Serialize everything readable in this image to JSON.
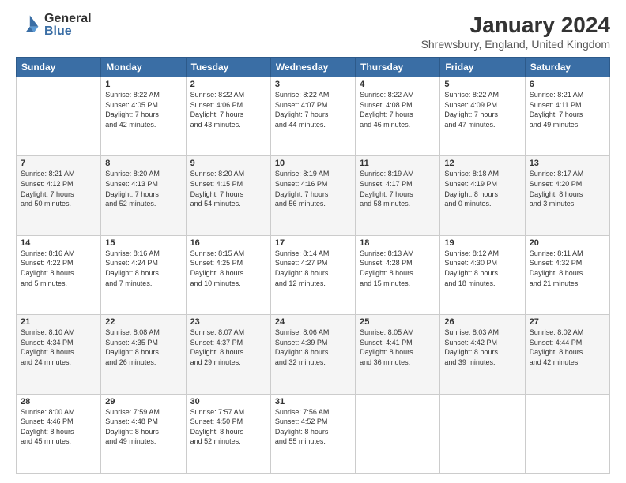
{
  "logo": {
    "general": "General",
    "blue": "Blue"
  },
  "title": "January 2024",
  "subtitle": "Shrewsbury, England, United Kingdom",
  "days_of_week": [
    "Sunday",
    "Monday",
    "Tuesday",
    "Wednesday",
    "Thursday",
    "Friday",
    "Saturday"
  ],
  "weeks": [
    [
      {
        "day": "",
        "info": ""
      },
      {
        "day": "1",
        "info": "Sunrise: 8:22 AM\nSunset: 4:05 PM\nDaylight: 7 hours\nand 42 minutes."
      },
      {
        "day": "2",
        "info": "Sunrise: 8:22 AM\nSunset: 4:06 PM\nDaylight: 7 hours\nand 43 minutes."
      },
      {
        "day": "3",
        "info": "Sunrise: 8:22 AM\nSunset: 4:07 PM\nDaylight: 7 hours\nand 44 minutes."
      },
      {
        "day": "4",
        "info": "Sunrise: 8:22 AM\nSunset: 4:08 PM\nDaylight: 7 hours\nand 46 minutes."
      },
      {
        "day": "5",
        "info": "Sunrise: 8:22 AM\nSunset: 4:09 PM\nDaylight: 7 hours\nand 47 minutes."
      },
      {
        "day": "6",
        "info": "Sunrise: 8:21 AM\nSunset: 4:11 PM\nDaylight: 7 hours\nand 49 minutes."
      }
    ],
    [
      {
        "day": "7",
        "info": "Sunrise: 8:21 AM\nSunset: 4:12 PM\nDaylight: 7 hours\nand 50 minutes."
      },
      {
        "day": "8",
        "info": "Sunrise: 8:20 AM\nSunset: 4:13 PM\nDaylight: 7 hours\nand 52 minutes."
      },
      {
        "day": "9",
        "info": "Sunrise: 8:20 AM\nSunset: 4:15 PM\nDaylight: 7 hours\nand 54 minutes."
      },
      {
        "day": "10",
        "info": "Sunrise: 8:19 AM\nSunset: 4:16 PM\nDaylight: 7 hours\nand 56 minutes."
      },
      {
        "day": "11",
        "info": "Sunrise: 8:19 AM\nSunset: 4:17 PM\nDaylight: 7 hours\nand 58 minutes."
      },
      {
        "day": "12",
        "info": "Sunrise: 8:18 AM\nSunset: 4:19 PM\nDaylight: 8 hours\nand 0 minutes."
      },
      {
        "day": "13",
        "info": "Sunrise: 8:17 AM\nSunset: 4:20 PM\nDaylight: 8 hours\nand 3 minutes."
      }
    ],
    [
      {
        "day": "14",
        "info": "Sunrise: 8:16 AM\nSunset: 4:22 PM\nDaylight: 8 hours\nand 5 minutes."
      },
      {
        "day": "15",
        "info": "Sunrise: 8:16 AM\nSunset: 4:24 PM\nDaylight: 8 hours\nand 7 minutes."
      },
      {
        "day": "16",
        "info": "Sunrise: 8:15 AM\nSunset: 4:25 PM\nDaylight: 8 hours\nand 10 minutes."
      },
      {
        "day": "17",
        "info": "Sunrise: 8:14 AM\nSunset: 4:27 PM\nDaylight: 8 hours\nand 12 minutes."
      },
      {
        "day": "18",
        "info": "Sunrise: 8:13 AM\nSunset: 4:28 PM\nDaylight: 8 hours\nand 15 minutes."
      },
      {
        "day": "19",
        "info": "Sunrise: 8:12 AM\nSunset: 4:30 PM\nDaylight: 8 hours\nand 18 minutes."
      },
      {
        "day": "20",
        "info": "Sunrise: 8:11 AM\nSunset: 4:32 PM\nDaylight: 8 hours\nand 21 minutes."
      }
    ],
    [
      {
        "day": "21",
        "info": "Sunrise: 8:10 AM\nSunset: 4:34 PM\nDaylight: 8 hours\nand 24 minutes."
      },
      {
        "day": "22",
        "info": "Sunrise: 8:08 AM\nSunset: 4:35 PM\nDaylight: 8 hours\nand 26 minutes."
      },
      {
        "day": "23",
        "info": "Sunrise: 8:07 AM\nSunset: 4:37 PM\nDaylight: 8 hours\nand 29 minutes."
      },
      {
        "day": "24",
        "info": "Sunrise: 8:06 AM\nSunset: 4:39 PM\nDaylight: 8 hours\nand 32 minutes."
      },
      {
        "day": "25",
        "info": "Sunrise: 8:05 AM\nSunset: 4:41 PM\nDaylight: 8 hours\nand 36 minutes."
      },
      {
        "day": "26",
        "info": "Sunrise: 8:03 AM\nSunset: 4:42 PM\nDaylight: 8 hours\nand 39 minutes."
      },
      {
        "day": "27",
        "info": "Sunrise: 8:02 AM\nSunset: 4:44 PM\nDaylight: 8 hours\nand 42 minutes."
      }
    ],
    [
      {
        "day": "28",
        "info": "Sunrise: 8:00 AM\nSunset: 4:46 PM\nDaylight: 8 hours\nand 45 minutes."
      },
      {
        "day": "29",
        "info": "Sunrise: 7:59 AM\nSunset: 4:48 PM\nDaylight: 8 hours\nand 49 minutes."
      },
      {
        "day": "30",
        "info": "Sunrise: 7:57 AM\nSunset: 4:50 PM\nDaylight: 8 hours\nand 52 minutes."
      },
      {
        "day": "31",
        "info": "Sunrise: 7:56 AM\nSunset: 4:52 PM\nDaylight: 8 hours\nand 55 minutes."
      },
      {
        "day": "",
        "info": ""
      },
      {
        "day": "",
        "info": ""
      },
      {
        "day": "",
        "info": ""
      }
    ]
  ]
}
